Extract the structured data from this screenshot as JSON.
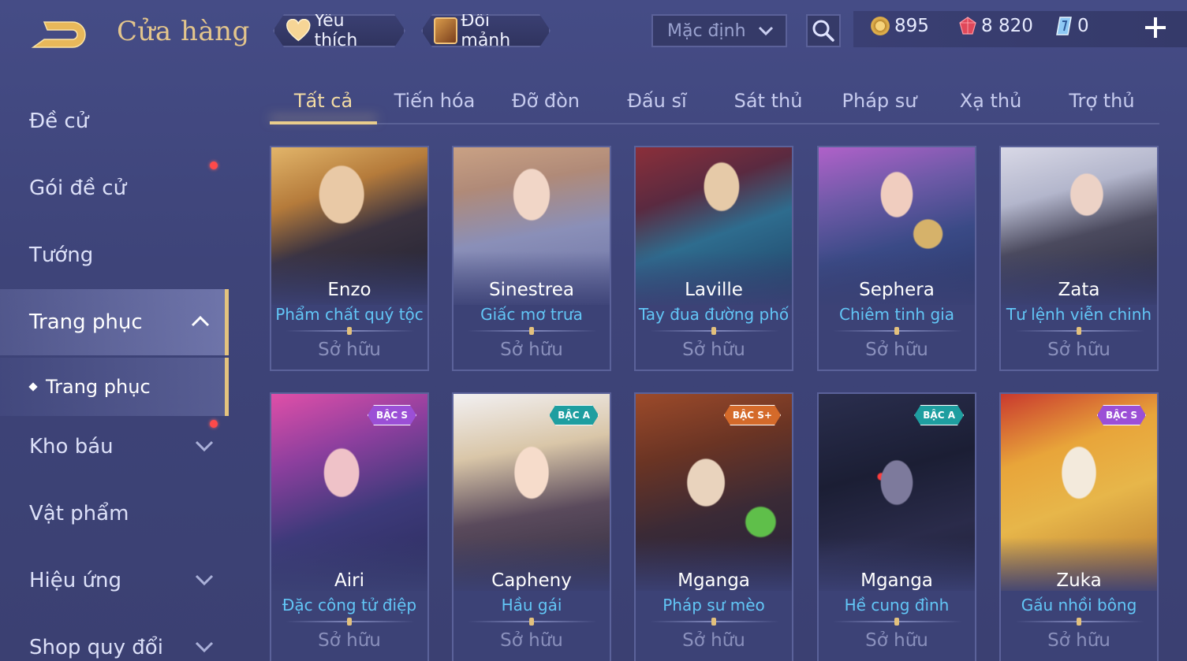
{
  "header": {
    "title": "Cửa hàng",
    "favorites_label": "Yêu thích",
    "exchange_label": "Đổi mảnh",
    "sort_value": "Mặc định"
  },
  "currency": {
    "gold": "895",
    "ruby": "8 820",
    "voucher": "0"
  },
  "sidebar": {
    "items": [
      {
        "label": "Đề cử"
      },
      {
        "label": "Gói đề cử"
      },
      {
        "label": "Tướng"
      },
      {
        "label": "Trang phục"
      },
      {
        "label": "Trang phục"
      },
      {
        "label": "Kho báu"
      },
      {
        "label": "Vật phẩm"
      },
      {
        "label": "Hiệu ứng"
      },
      {
        "label": "Shop quy đổi"
      }
    ]
  },
  "tabs": [
    {
      "label": "Tất cả"
    },
    {
      "label": "Tiến hóa"
    },
    {
      "label": "Đỡ đòn"
    },
    {
      "label": "Đấu sĩ"
    },
    {
      "label": "Sát thủ"
    },
    {
      "label": "Pháp sư"
    },
    {
      "label": "Xạ thủ"
    },
    {
      "label": "Trợ thủ"
    }
  ],
  "cards": [
    {
      "hero": "Enzo",
      "skin": "Phẩm chất quý tộc",
      "status": "Sở hữu",
      "tier": ""
    },
    {
      "hero": "Sinestrea",
      "skin": "Giấc mơ trưa",
      "status": "Sở hữu",
      "tier": ""
    },
    {
      "hero": "Laville",
      "skin": "Tay đua đường phố",
      "status": "Sở hữu",
      "tier": ""
    },
    {
      "hero": "Sephera",
      "skin": "Chiêm tinh gia",
      "status": "Sở hữu",
      "tier": ""
    },
    {
      "hero": "Zata",
      "skin": "Tư lệnh viễn chinh",
      "status": "Sở hữu",
      "tier": ""
    },
    {
      "hero": "Airi",
      "skin": "Đặc công tử điệp",
      "status": "Sở hữu",
      "tier": "BẬC S"
    },
    {
      "hero": "Capheny",
      "skin": "Hầu gái",
      "status": "Sở hữu",
      "tier": "BẬC A"
    },
    {
      "hero": "Mganga",
      "skin": "Pháp sư mèo",
      "status": "Sở hữu",
      "tier": "BẬC S+"
    },
    {
      "hero": "Mganga",
      "skin": "Hề cung đình",
      "status": "Sở hữu",
      "tier": "BẬC A"
    },
    {
      "hero": "Zuka",
      "skin": "Gấu nhồi bông",
      "status": "Sở hữu",
      "tier": "BẬC S"
    }
  ],
  "colors": {
    "accent_gold": "#e4c37e",
    "skin_name_blue": "#62c6f6",
    "tier_s": "#9b4fd6",
    "tier_a": "#1e9ea0",
    "tier_s_plus": "#d46a2a"
  },
  "icons": {
    "back": "back-arrow-icon",
    "favorite": "heart-icon",
    "exchange": "chest-icon",
    "sort": "chevron-down-icon",
    "search": "search-icon",
    "gold": "coin-icon",
    "ruby": "ruby-icon",
    "voucher": "voucher-icon",
    "add": "plus-icon"
  }
}
